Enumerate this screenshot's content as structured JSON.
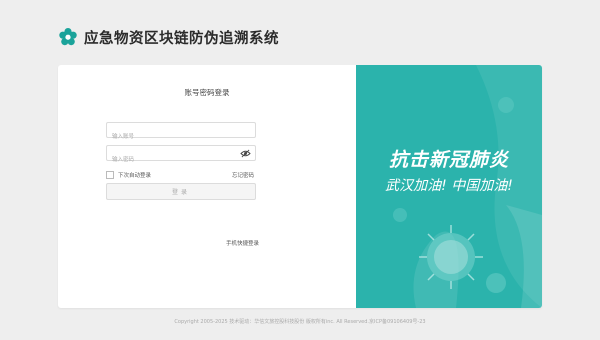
{
  "header": {
    "logo_icon": "flower-icon",
    "title": "应急物资区块链防伪追溯系统"
  },
  "login": {
    "title": "账号密码登录",
    "account_placeholder": "输入账号",
    "password_placeholder": "输入密码",
    "password_toggle_icon": "eye-off-icon",
    "remember_label": "下次自动登录",
    "forgot_label": "忘记密码",
    "submit_label": "登录",
    "phone_login_label": "手机快捷登录"
  },
  "banner": {
    "slogan_main": "抗击新冠肺炎",
    "slogan_sub": "武汉加油! 中国加油!",
    "background_color": "#2bb3ac",
    "illustration_icon": "virus-icon"
  },
  "footer": {
    "copyright": "Copyright 2005-2025 技术驱动：华信文旅控股科技股份 版权所有inc. All Reserved.京ICP备09106409号-23"
  },
  "colors": {
    "accent": "#2bb3ac",
    "page_background": "#eeeeee"
  }
}
